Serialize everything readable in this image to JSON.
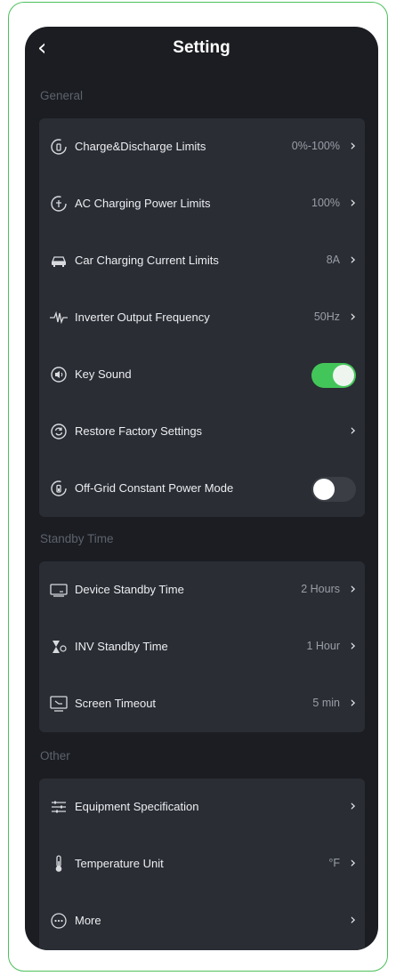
{
  "header": {
    "title": "Setting",
    "back_icon": "chevron-left-icon"
  },
  "sections": {
    "general": {
      "label": "General",
      "items": [
        {
          "label": "Charge&Discharge Limits",
          "value": "0%-100%",
          "icon": "battery-gauge-icon"
        },
        {
          "label": "AC Charging Power Limits",
          "value": "100%",
          "icon": "plug-gauge-icon"
        },
        {
          "label": "Car Charging Current Limits",
          "value": "8A",
          "icon": "car-icon"
        },
        {
          "label": "Inverter Output Frequency",
          "value": "50Hz",
          "icon": "waveform-icon"
        },
        {
          "label": "Key Sound",
          "toggle": "on",
          "icon": "speaker-icon"
        },
        {
          "label": "Restore Factory Settings",
          "value": "",
          "icon": "restore-icon"
        },
        {
          "label": "Off-Grid Constant Power Mode",
          "toggle": "off",
          "icon": "battery-circle-icon"
        }
      ]
    },
    "standby": {
      "label": "Standby Time",
      "items": [
        {
          "label": "Device Standby Time",
          "value": "2 Hours",
          "icon": "device-icon"
        },
        {
          "label": "INV Standby Time",
          "value": "1 Hour",
          "icon": "hourglass-icon"
        },
        {
          "label": "Screen Timeout",
          "value": "5 min",
          "icon": "screen-icon"
        }
      ]
    },
    "other": {
      "label": "Other",
      "items": [
        {
          "label": "Equipment Specification",
          "value": "",
          "icon": "sliders-icon"
        },
        {
          "label": "Temperature Unit",
          "value": "°F",
          "icon": "thermometer-icon"
        },
        {
          "label": "More",
          "value": "",
          "icon": "more-icon"
        }
      ]
    }
  },
  "colors": {
    "accent": "#43c659",
    "background": "#1b1d22",
    "card": "#2a2d34",
    "frame": "#4cc05a"
  }
}
